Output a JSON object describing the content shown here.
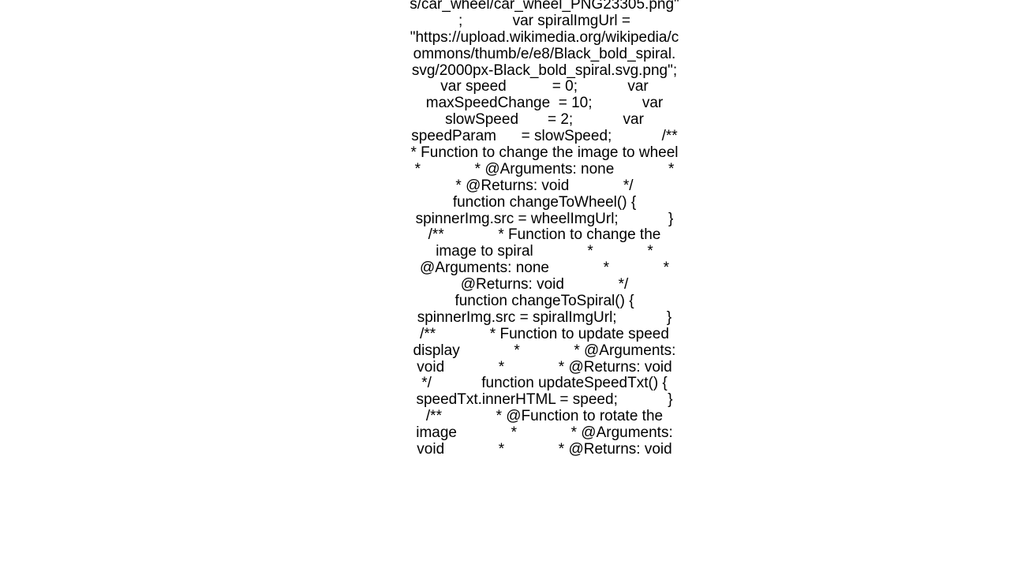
{
  "code_text": "s/car_wheel/car_wheel_PNG23305.png\";            var spiralImgUrl = \"https://upload.wikimedia.org/wikipedia/commons/thumb/e/e8/Black_bold_spiral.svg/2000px-Black_bold_spiral.svg.png\";            var speed           = 0;            var maxSpeedChange  = 10;            var slowSpeed       = 2;            var speedParam      = slowSpeed;            /**             * Function to change the image to wheel             *             * @Arguments: none             *             * @Returns: void             */            function changeToWheel() {                spinnerImg.src = wheelImgUrl;            }                        /**             * Function to change the image to spiral             *             * @Arguments: none             *             * @Returns: void             */            function changeToSpiral() {                spinnerImg.src = spiralImgUrl;            }                        /**             * Function to update speed display             *             * @Arguments: void             *             * @Returns: void             */            function updateSpeedTxt() {                speedTxt.innerHTML = speed;            }                        /**             * @Function to rotate the image             *             * @Arguments: void             *             * @Returns: void"
}
